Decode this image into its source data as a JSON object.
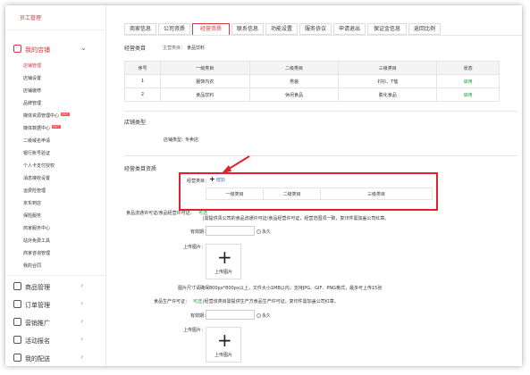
{
  "sidebar": {
    "top_label": "员工管理",
    "store_group": "我的店铺",
    "store_items": [
      {
        "label": "店铺管理",
        "current": true,
        "hot": false
      },
      {
        "label": "店铺设置",
        "current": false,
        "hot": false
      },
      {
        "label": "店铺装修",
        "current": false,
        "hot": false
      },
      {
        "label": "品牌管理",
        "current": false,
        "hot": false
      },
      {
        "label": "媒体资源管理中心",
        "current": false,
        "hot": true
      },
      {
        "label": "媒体数据中心",
        "current": false,
        "hot": true
      },
      {
        "label": "二级域名申请",
        "current": false,
        "hot": false
      },
      {
        "label": "银行账号验证",
        "current": false,
        "hot": false
      },
      {
        "label": "个人卡支付授权",
        "current": false,
        "hot": false
      },
      {
        "label": "消息接收设置",
        "current": false,
        "hot": false
      },
      {
        "label": "运费险管理",
        "current": false,
        "hot": false
      },
      {
        "label": "京东到店",
        "current": false,
        "hot": false
      },
      {
        "label": "保险服务",
        "current": false,
        "hot": false
      },
      {
        "label": "商家服务中心",
        "current": false,
        "hot": false
      },
      {
        "label": "站外免费工具",
        "current": false,
        "hot": false
      },
      {
        "label": "商家咨询管理",
        "current": false,
        "hot": false
      },
      {
        "label": "我的合同",
        "current": false,
        "hot": false
      }
    ],
    "hot_badge": "HOT",
    "groups": [
      "商品管理",
      "订单管理",
      "营销推广",
      "活动报名",
      "我的配送"
    ]
  },
  "tabs": [
    "商家信息",
    "公司资质",
    "经营资质",
    "联系信息",
    "功能设置",
    "服务协议",
    "申请退出",
    "保证金信息",
    "返回比例"
  ],
  "active_tab": 2,
  "business_category": {
    "title": "经营类目",
    "main_label": "主营类目：",
    "main_value": "食品饮料",
    "headers": [
      "序号",
      "一级类目",
      "二级类目",
      "三级类目",
      "状态"
    ],
    "rows": [
      [
        "1",
        "服饰内衣",
        "男装",
        "衬衫、T恤",
        "启用"
      ],
      [
        "2",
        "食品饮料",
        "休闲食品",
        "膨化食品",
        "启用"
      ]
    ]
  },
  "store_type": {
    "title": "店铺类型",
    "label": "店铺类型：",
    "value": "专卖店"
  },
  "qualification": {
    "title": "经营类目资质",
    "cat_label": "经营类目：",
    "add_text": "增加",
    "headers": [
      "一级类目",
      "二级类目",
      "三级类目"
    ],
    "license_label": "食品流通许可证/食品经营许可证：",
    "license_tag": "可选",
    "license_desc": "|需提供贵公司的食品流通许可证/食品经营许可证，经营范围须一致，复印件需加盖公司红章。",
    "validity_label": "有效期：",
    "permanent": "永久",
    "upload_label": "上传图片：",
    "upload_text": "上传图片",
    "size_note": "图片尺寸请确保800px*800px以上，文件大小1MB以内，支持JPG、GIF、PNG格式，最多可上传15张",
    "production_label": "食品生产许可证：",
    "production_tag": "可选",
    "production_desc": "|经营该类目需提供生产方食品生产许可证，复印件需加盖公司红章。"
  }
}
